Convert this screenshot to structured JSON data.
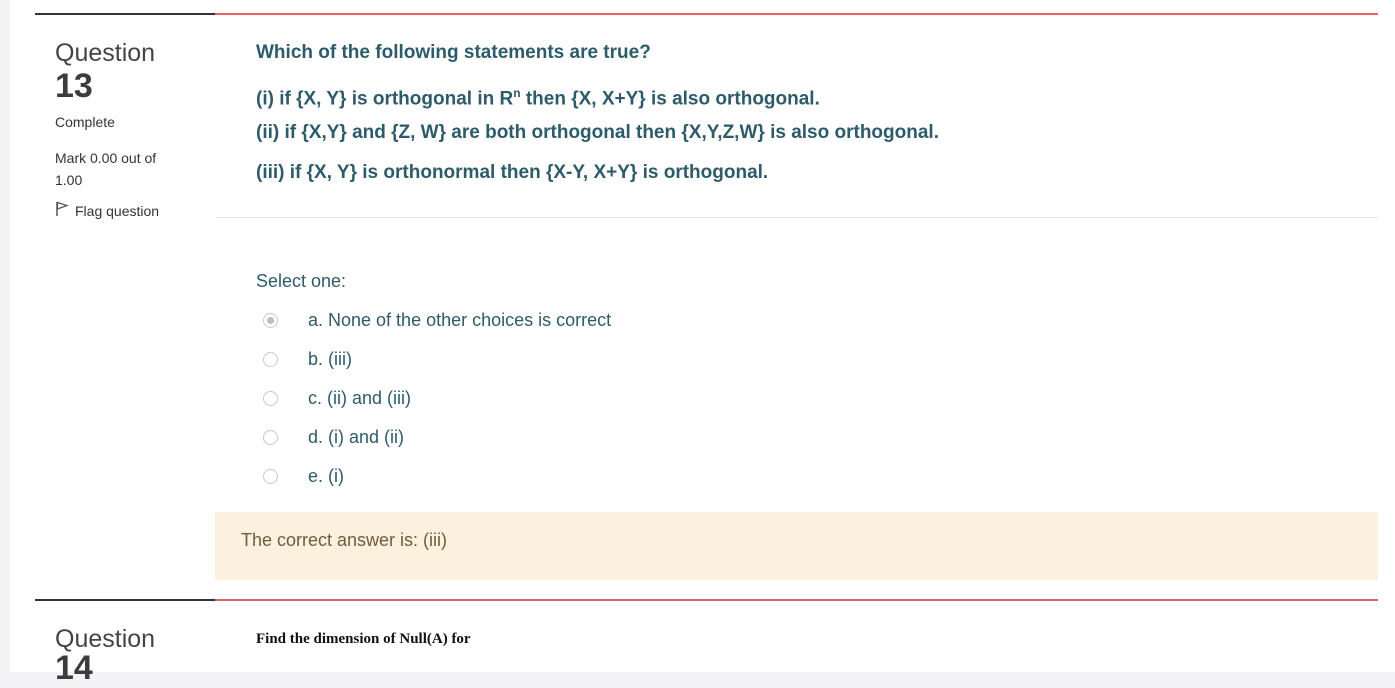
{
  "question13": {
    "label": "Question",
    "number": "13",
    "state": "Complete",
    "grade": "Mark 0.00 out of 1.00",
    "flag_label": "Flag question",
    "text_title": "Which of the following statements are true?",
    "statement1_pre": "(i) if {X, Y} is orthogonal in R",
    "statement1_sup": "n",
    "statement1_post": " then {X, X+Y} is also orthogonal.",
    "statement2": "(ii) if {X,Y} and {Z, W} are both orthogonal then {X,Y,Z,W} is also orthogonal.",
    "statement3": "(iii) if {X, Y} is orthonormal then {X-Y, X+Y} is orthogonal.",
    "prompt": "Select one:",
    "options": [
      {
        "label": "a. None of the other choices is correct",
        "selected": true
      },
      {
        "label": "b. (iii)",
        "selected": false
      },
      {
        "label": "c. (ii) and (iii)",
        "selected": false
      },
      {
        "label": "d. (i) and (ii)",
        "selected": false
      },
      {
        "label": "e. (i)",
        "selected": false
      }
    ],
    "right_answer": "The correct answer is: (iii)"
  },
  "question14": {
    "label": "Question",
    "number": "14",
    "text": "Find the dimension of Null(A) for"
  },
  "colors": {
    "accent_line": "#e8616b",
    "question_text": "#2e5b6a",
    "feedback_bg": "#fcf0df"
  }
}
